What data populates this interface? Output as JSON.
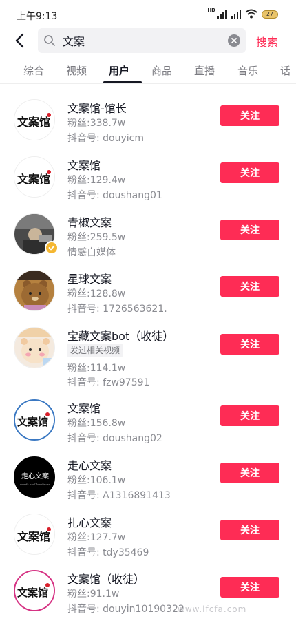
{
  "status_bar": {
    "time": "上午9:13",
    "hd": "HD",
    "battery": "27"
  },
  "search": {
    "query": "文案",
    "search_label": "搜索"
  },
  "tabs": [
    "综合",
    "视频",
    "用户",
    "商品",
    "直播",
    "音乐",
    "话"
  ],
  "active_tab": "用户",
  "follow_label": "关注",
  "users": [
    {
      "name": "文案馆-馆长",
      "fans": "粉丝:338.7w",
      "id": "抖音号: douyicm",
      "avatar": "wenanguan-logo"
    },
    {
      "name": "文案馆",
      "fans": "粉丝:129.4w",
      "id": "抖音号: doushang01",
      "avatar": "wenanguan-logo"
    },
    {
      "name": "青椒文案",
      "fans": "粉丝:259.5w",
      "id": "情感自媒体",
      "avatar": "photo-person",
      "verified": true
    },
    {
      "name": "星球文案",
      "fans": "粉丝:128.8w",
      "id": "抖音号: 1726563621.",
      "avatar": "bear-cartoon"
    },
    {
      "name": "宝藏文案bot（收徒）",
      "tag": "发过相关视频",
      "fans": "粉丝:114.1w",
      "id": "抖音号: fzw97591",
      "avatar": "bear-cartoon-pink"
    },
    {
      "name": "文案馆",
      "fans": "粉丝:156.8w",
      "id": "抖音号: doushang02",
      "avatar": "wenanguan-logo-blue-ring"
    },
    {
      "name": "走心文案",
      "fans": "粉丝:106.1w",
      "id": "抖音号: A1316891413",
      "avatar": "zouxin-black-logo",
      "avatar_text": "走心文案",
      "avatar_sub": "words heal loneliness"
    },
    {
      "name": "扎心文案",
      "fans": "粉丝:127.7w",
      "id": "抖音号: tdy35469",
      "avatar": "wenanguan-logo"
    },
    {
      "name": "文案馆（收徒）",
      "fans": "粉丝:91.1w",
      "id": "抖音号: douyin10190322",
      "avatar": "wenanguan-logo-pink-ring"
    }
  ],
  "logo_text": "文案馆",
  "watermark": "www.lfcfa.com"
}
